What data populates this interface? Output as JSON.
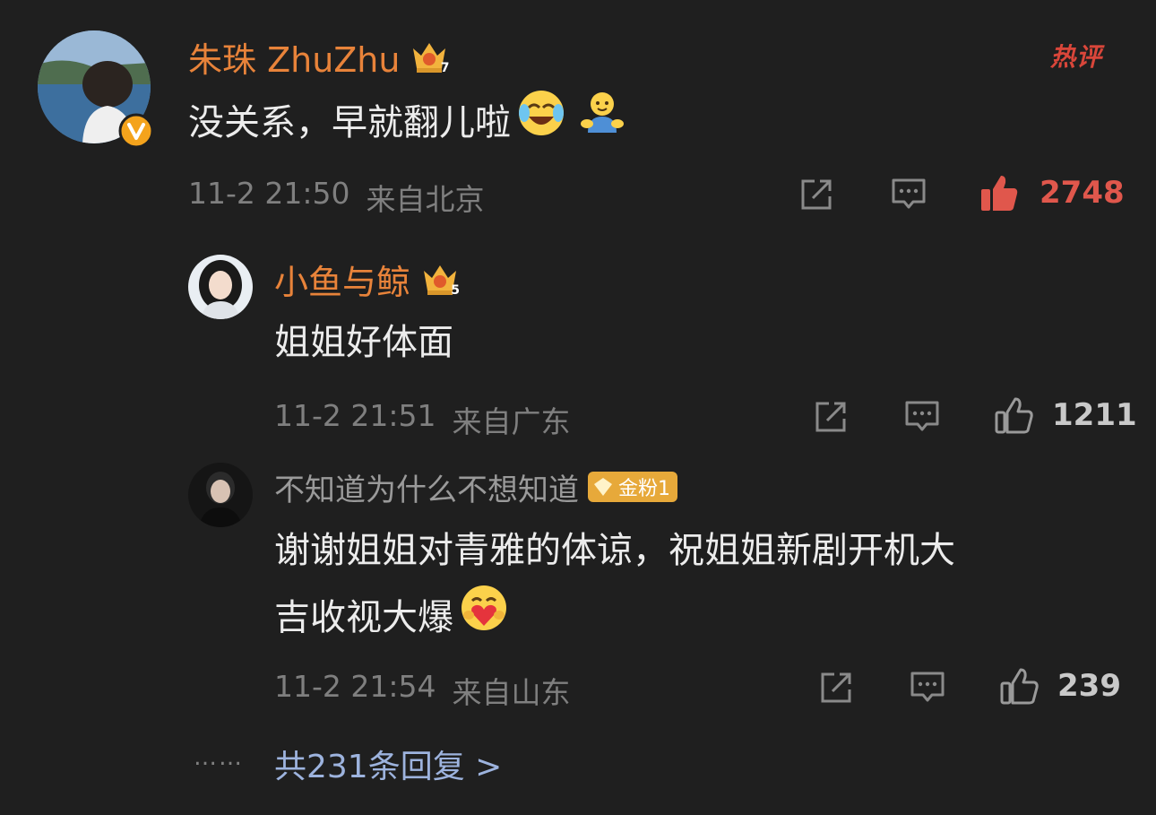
{
  "comments": [
    {
      "user": "朱珠 ZhuZhu",
      "level": "7",
      "text": "没关系，早就翻儿啦",
      "emojis": [
        "laughing-crying-emoji",
        "hug-emoji"
      ],
      "time": "11-2 21:50",
      "location": "来自北京",
      "likes": "2748",
      "verified": true,
      "hot_badge": "热评"
    },
    {
      "user": "小鱼与鲸",
      "level": "5",
      "text": "姐姐好体面",
      "time": "11-2 21:51",
      "location": "来自广东",
      "likes": "1211"
    },
    {
      "user": "不知道为什么不想知道",
      "fan_badge": "金粉1",
      "text_line1": "谢谢姐姐对青雅的体谅，祝姐姐新剧开机大",
      "text_line2": "吉收视大爆",
      "emojis": [
        "heart-hug-emoji"
      ],
      "time": "11-2 21:54",
      "location": "来自山东",
      "likes": "239"
    }
  ],
  "footer": {
    "dots": "……",
    "more_replies": "共231条回复 >"
  },
  "colors": {
    "background": "#1f1f1f",
    "username": "#e8833a",
    "hot": "#e0574c",
    "link": "#9db3de"
  }
}
